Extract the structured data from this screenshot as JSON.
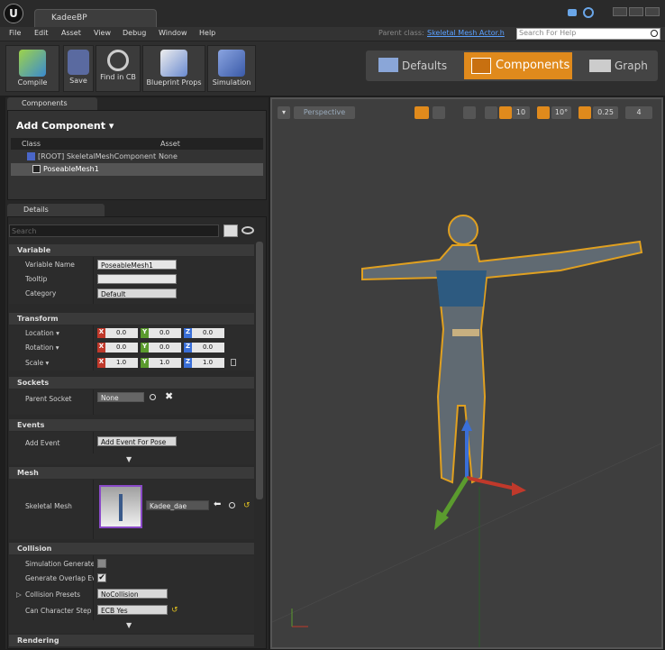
{
  "window": {
    "tab_title": "KadeeBP",
    "logo": "U"
  },
  "menu": [
    "File",
    "Edit",
    "Asset",
    "View",
    "Debug",
    "Window",
    "Help"
  ],
  "parent_class_label": "Parent class:",
  "parent_class_value": "Skeletal Mesh Actor.h",
  "search_help_placeholder": "Search For Help",
  "toolbar": {
    "compile": "Compile",
    "save": "Save",
    "find": "Find in CB",
    "props": "Blueprint Props",
    "sim": "Simulation"
  },
  "modes": {
    "defaults": "Defaults",
    "components": "Components",
    "graph": "Graph"
  },
  "components_panel": {
    "tab": "Components",
    "add": "Add Component ▾",
    "col_class": "Class",
    "col_asset": "Asset",
    "root_class": "[ROOT] SkeletalMeshComponent",
    "root_asset": "None",
    "child": "PoseableMesh1"
  },
  "details": {
    "tab": "Details",
    "search_placeholder": "Search",
    "variable": {
      "title": "Variable",
      "name_label": "Variable Name",
      "name_value": "PoseableMesh1",
      "tooltip_label": "Tooltip",
      "tooltip_value": "",
      "category_label": "Category",
      "category_value": "Default"
    },
    "transform": {
      "title": "Transform",
      "location": "Location ▾",
      "rotation": "Rotation ▾",
      "scale": "Scale ▾",
      "loc": [
        "0.0",
        "0.0",
        "0.0"
      ],
      "rot": [
        "0.0",
        "0.0",
        "0.0"
      ],
      "scl": [
        "1.0",
        "1.0",
        "1.0"
      ],
      "axes": [
        "X",
        "Y",
        "Z"
      ]
    },
    "sockets": {
      "title": "Sockets",
      "parent_label": "Parent Socket",
      "parent_value": "None"
    },
    "events": {
      "title": "Events",
      "add_label": "Add Event",
      "add_value": "Add Event For Pose"
    },
    "mesh": {
      "title": "Mesh",
      "label": "Skeletal Mesh",
      "value": "Kadee_dae"
    },
    "collision": {
      "title": "Collision",
      "sim_label": "Simulation Generates",
      "overlap_label": "Generate Overlap Ev",
      "presets_label": "Collision Presets",
      "presets_value": "NoCollision",
      "step_label": "Can Character Step U",
      "step_value": "ECB Yes"
    },
    "rendering": {
      "title": "Rendering"
    }
  },
  "viewport": {
    "perspective": "Perspective",
    "grid": "10",
    "rot": "10°",
    "scale": "0.25",
    "cam": "4"
  },
  "colors": {
    "accent": "#e08a1c",
    "x": "#c0392b",
    "y": "#5b9b2e",
    "z": "#3a6fd8"
  }
}
